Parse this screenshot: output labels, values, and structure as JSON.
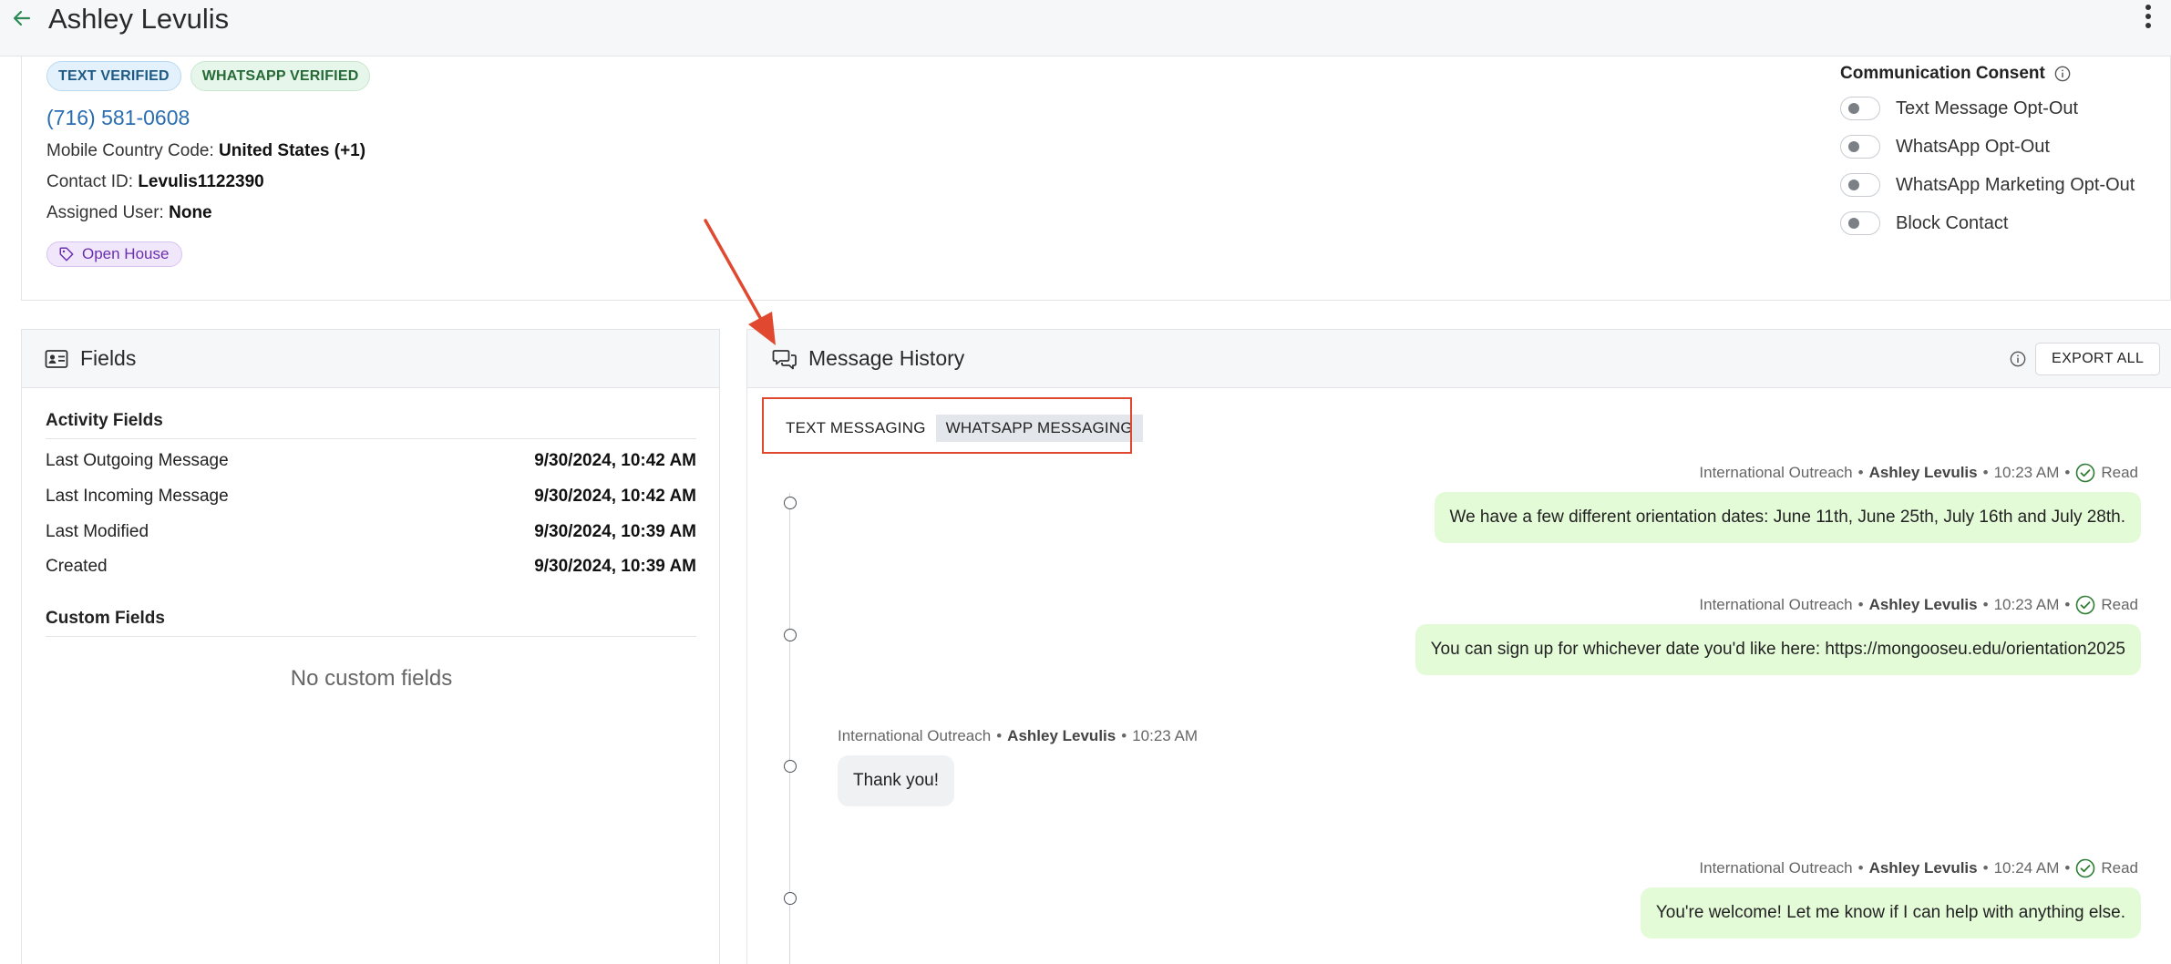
{
  "header": {
    "title": "Ashley Levulis",
    "back_icon": "arrow-left-icon",
    "menu_icon": "kebab-vertical-icon"
  },
  "contact": {
    "badges": [
      "TEXT VERIFIED",
      "WHATSAPP VERIFIED"
    ],
    "phone": "(716) 581-0608",
    "mobile_country_label": "Mobile Country Code:",
    "mobile_country_value": "United States (+1)",
    "contact_id_label": "Contact ID:",
    "contact_id_value": "Levulis1122390",
    "assigned_user_label": "Assigned User:",
    "assigned_user_value": "None",
    "tag": "Open House"
  },
  "consent": {
    "title": "Communication Consent",
    "toggles": [
      {
        "label": "Text Message Opt-Out",
        "on": false
      },
      {
        "label": "WhatsApp Opt-Out",
        "on": false
      },
      {
        "label": "WhatsApp Marketing Opt-Out",
        "on": false
      },
      {
        "label": "Block Contact",
        "on": false
      }
    ]
  },
  "fields": {
    "title": "Fields",
    "activity_title": "Activity Fields",
    "activity": [
      {
        "label": "Last Outgoing Message",
        "value": "9/30/2024, 10:42 AM"
      },
      {
        "label": "Last Incoming Message",
        "value": "9/30/2024, 10:42 AM"
      },
      {
        "label": "Last Modified",
        "value": "9/30/2024, 10:39 AM"
      },
      {
        "label": "Created",
        "value": "9/30/2024, 10:39 AM"
      }
    ],
    "custom_title": "Custom Fields",
    "custom_empty": "No custom fields"
  },
  "messages": {
    "title": "Message History",
    "export_label": "EXPORT ALL",
    "tabs": [
      {
        "label": "TEXT MESSAGING",
        "active": false
      },
      {
        "label": "WHATSAPP MESSAGING",
        "active": true
      }
    ],
    "items": [
      {
        "direction": "out",
        "source": "International Outreach",
        "sender": "Ashley Levulis",
        "time": "10:23 AM",
        "status": "Read",
        "text": "We have a few different orientation dates: June 11th, June 25th, July 16th and July 28th."
      },
      {
        "direction": "out",
        "source": "International Outreach",
        "sender": "Ashley Levulis",
        "time": "10:23 AM",
        "status": "Read",
        "text": "You can sign up for whichever date you'd like here: https://mongooseu.edu/orientation2025"
      },
      {
        "direction": "in",
        "source": "International Outreach",
        "sender": "Ashley Levulis",
        "time": "10:23 AM",
        "status": "",
        "text": "Thank you!"
      },
      {
        "direction": "out",
        "source": "International Outreach",
        "sender": "Ashley Levulis",
        "time": "10:24 AM",
        "status": "Read",
        "text": "You're welcome! Let me know if I can help with anything else."
      }
    ],
    "separator": "•"
  },
  "colors": {
    "accent_link": "#2a6db0",
    "outgoing_bubble": "#e4fbd8",
    "incoming_bubble": "#f0f1f3",
    "annotation": "#e0492f",
    "read_check": "#2e7d32"
  }
}
